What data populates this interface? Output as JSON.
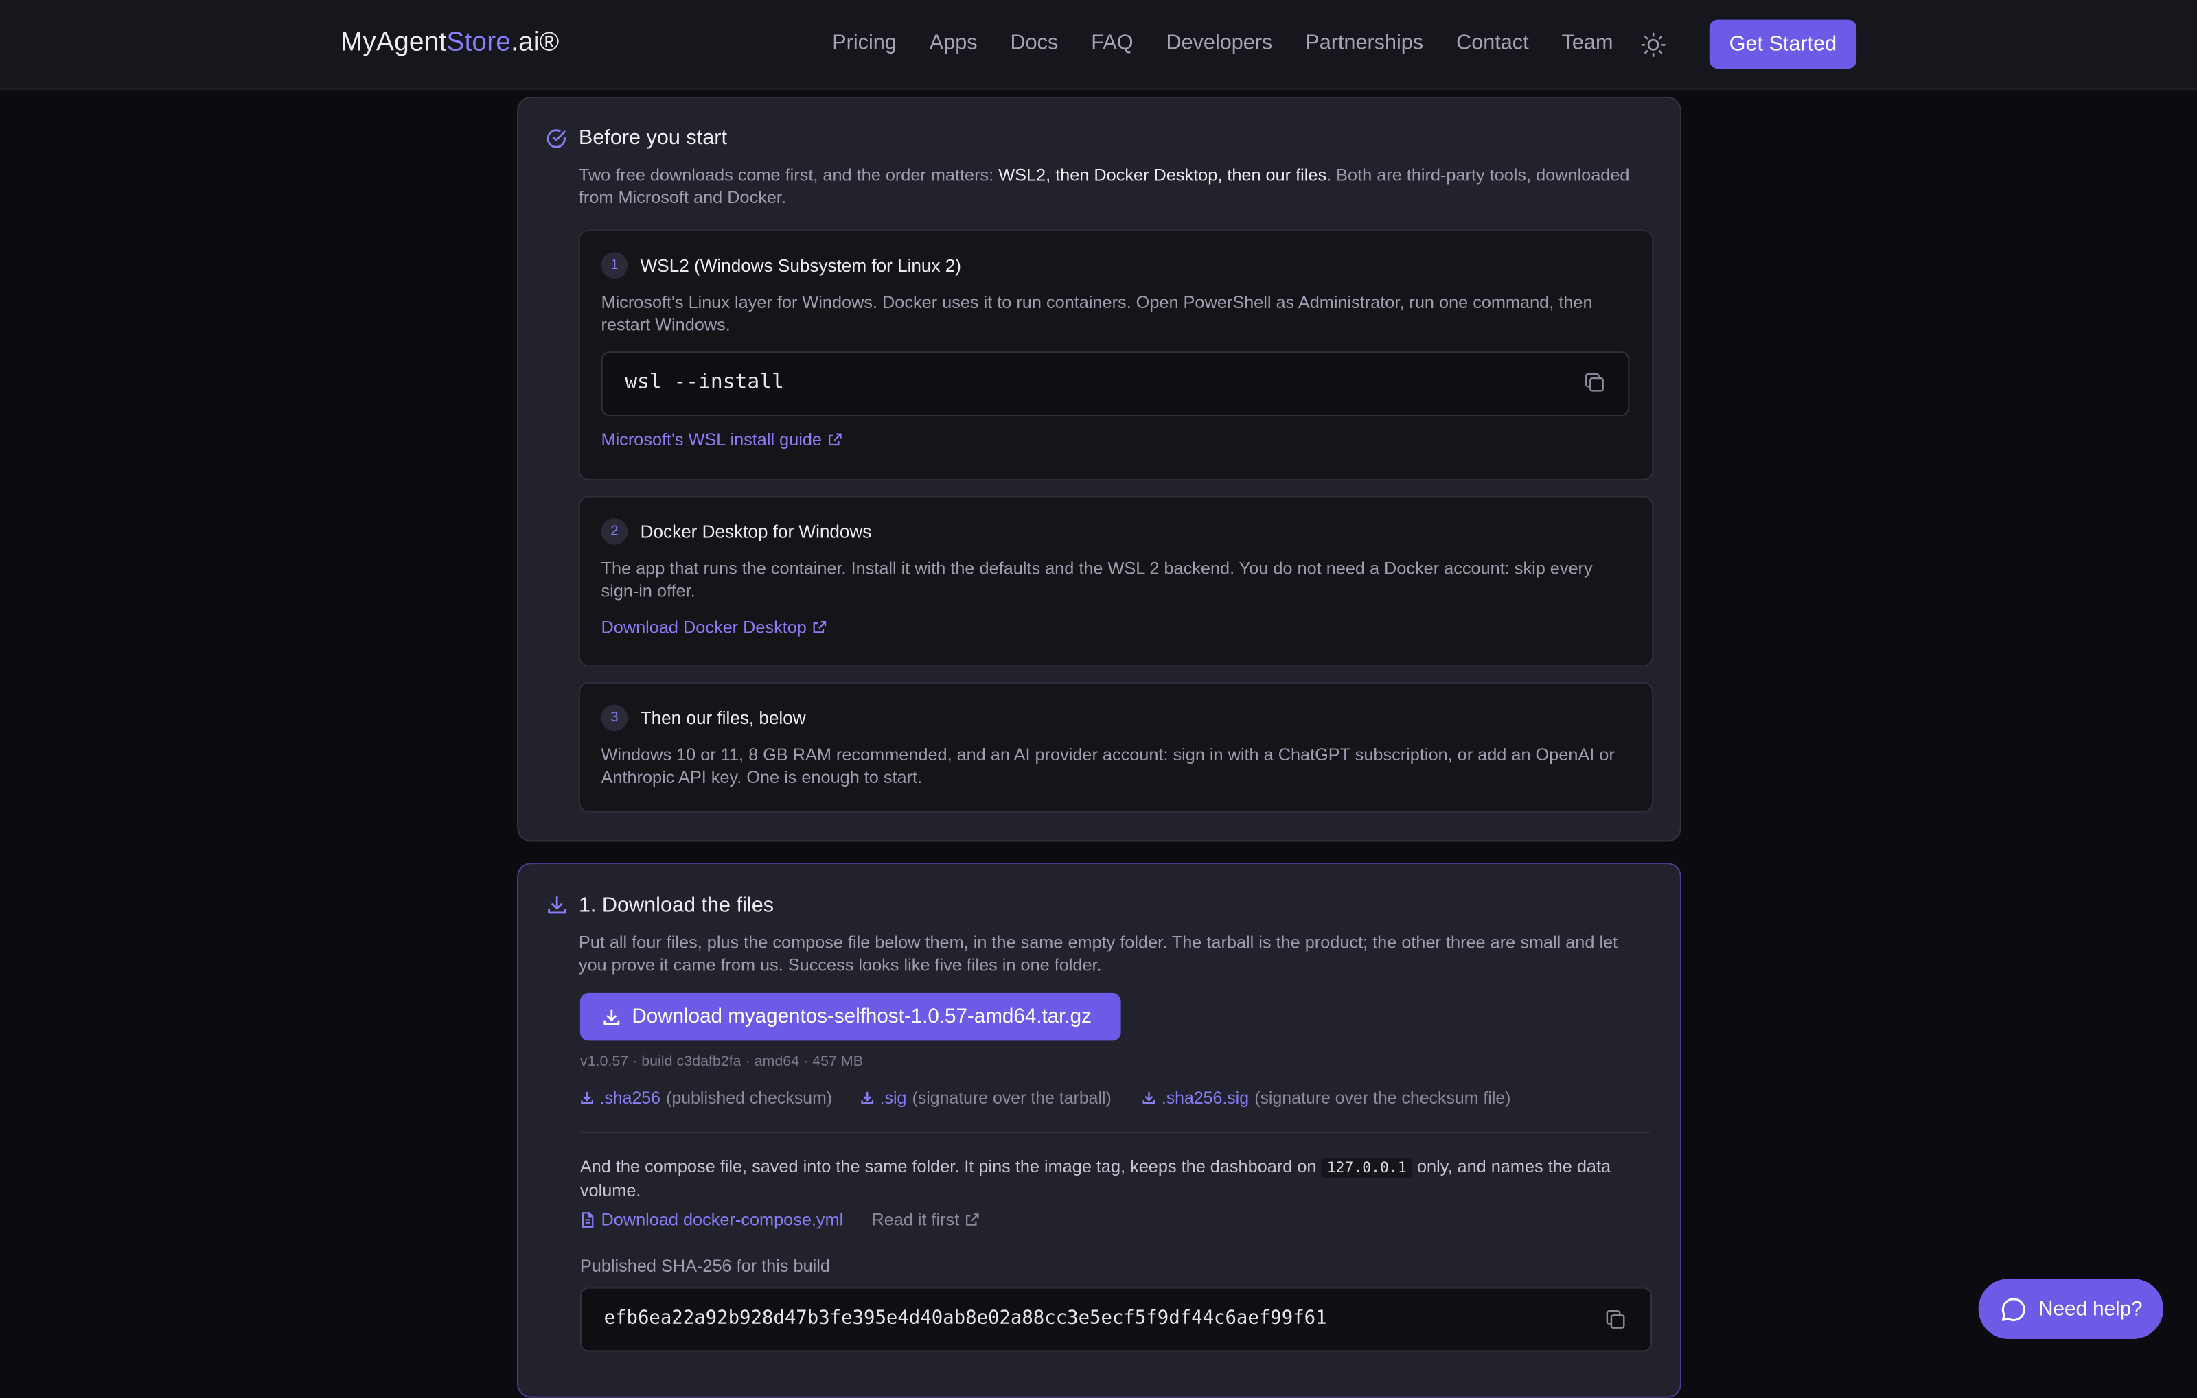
{
  "header": {
    "logo_pre": "MyAgent",
    "logo_accent": "Store",
    "logo_post": ".ai®",
    "nav": [
      "Pricing",
      "Apps",
      "Docs",
      "FAQ",
      "Developers",
      "Partnerships",
      "Contact",
      "Team"
    ],
    "cta": "Get Started",
    "theme_icon": "sun-icon"
  },
  "before": {
    "title": "Before you start",
    "intro_a": "Two free downloads come first, and the order matters: ",
    "intro_strong": "WSL2, then Docker Desktop, then our files",
    "intro_b": ". Both are third-party tools, downloaded",
    "intro_c": "from Microsoft and Docker.",
    "steps": [
      {
        "num": "1",
        "title": "WSL2 (Windows Subsystem for Linux 2)",
        "text_a": "Microsoft's Linux layer for Windows. Docker uses it to run containers. Open PowerShell as Administrator, run one command, then",
        "text_b": "restart Windows.",
        "command": "wsl --install",
        "link": "Microsoft's WSL install guide"
      },
      {
        "num": "2",
        "title": "Docker Desktop for Windows",
        "text_a": "The app that runs the container. Install it with the defaults and the WSL 2 backend. You do not need a Docker account: skip every",
        "text_b": "sign-in offer.",
        "link": "Download Docker Desktop"
      },
      {
        "num": "3",
        "title": "Then our files, below",
        "text_a": "Windows 10 or 11, 8 GB RAM recommended, and an AI provider account: sign in with a ChatGPT subscription, or add an OpenAI or",
        "text_b": "Anthropic API key. One is enough to start."
      }
    ]
  },
  "download": {
    "title": "1. Download the files",
    "text_a": "Put all four files, plus the compose file below them, in the same empty folder. The tarball is the product; the other three are small and let",
    "text_b": "you prove it came from us. Success looks like five files in one folder.",
    "button": "Download myagentos-selfhost-1.0.57-amd64.tar.gz",
    "meta": "v1.0.57 · build c3dafb2fa · amd64 · 457 MB",
    "aux": [
      {
        "link": ".sha256",
        "desc": "(published checksum)"
      },
      {
        "link": ".sig",
        "desc": "(signature over the tarball)"
      },
      {
        "link": ".sha256.sig",
        "desc": "(signature over the checksum file)"
      }
    ],
    "compose_a": "And the compose file, saved into the same folder. It pins the image tag, keeps the dashboard on ",
    "compose_code": "127.0.0.1",
    "compose_b": " only, and names the data",
    "compose_c": "volume.",
    "compose_link": "Download docker-compose.yml",
    "read_first": "Read it first",
    "sha_label": "Published SHA-256 for this build",
    "sha_value": "efb6ea22a92b928d47b3fe395e4d40ab8e02a88cc3e5ecf5f9df44c6aef99f61"
  },
  "help": {
    "label": "Need help?"
  }
}
